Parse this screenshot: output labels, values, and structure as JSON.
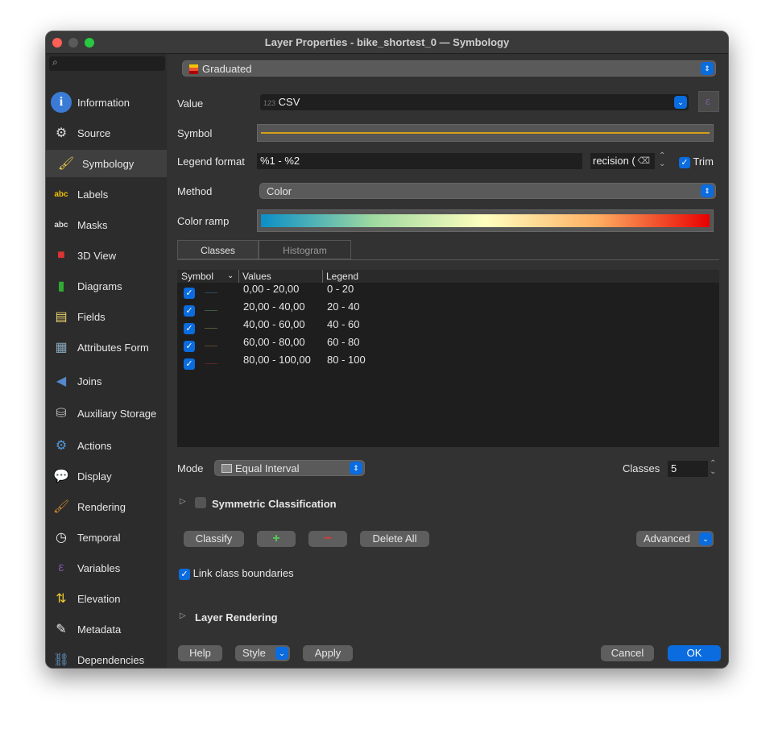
{
  "window": {
    "title": "Layer Properties - bike_shortest_0 — Symbology"
  },
  "sidebar": {
    "items": [
      {
        "label": "Information",
        "icon": "info-icon"
      },
      {
        "label": "Source",
        "icon": "source-icon"
      },
      {
        "label": "Symbology",
        "icon": "symbology-icon",
        "selected": true
      },
      {
        "label": "Labels",
        "icon": "labels-icon"
      },
      {
        "label": "Masks",
        "icon": "masks-icon"
      },
      {
        "label": "3D View",
        "icon": "cube-icon"
      },
      {
        "label": "Diagrams",
        "icon": "diagrams-icon"
      },
      {
        "label": "Fields",
        "icon": "fields-icon"
      },
      {
        "label": "Attributes Form",
        "icon": "form-icon"
      },
      {
        "label": "Joins",
        "icon": "joins-icon"
      },
      {
        "label": "Auxiliary Storage",
        "icon": "storage-icon"
      },
      {
        "label": "Actions",
        "icon": "actions-icon"
      },
      {
        "label": "Display",
        "icon": "display-icon"
      },
      {
        "label": "Rendering",
        "icon": "brush-icon"
      },
      {
        "label": "Temporal",
        "icon": "clock-icon"
      },
      {
        "label": "Variables",
        "icon": "variables-icon"
      },
      {
        "label": "Elevation",
        "icon": "elevation-icon"
      },
      {
        "label": "Metadata",
        "icon": "metadata-icon"
      },
      {
        "label": "Dependencies",
        "icon": "dependencies-icon"
      }
    ]
  },
  "renderer": "Graduated",
  "form": {
    "value_label": "Value",
    "value_type": "123",
    "value": "CSV",
    "symbol_label": "Symbol",
    "symbol_color": "#d4a017",
    "legend_format_label": "Legend format",
    "legend_format": "%1 - %2",
    "precision": "recision (",
    "trim_label": "Trim",
    "trim_checked": true,
    "method_label": "Method",
    "method": "Color",
    "color_ramp_label": "Color ramp"
  },
  "color_ramp": [
    "#0a8fc8",
    "#9fd9a0",
    "#ffffbf",
    "#fdae61",
    "#e80000"
  ],
  "tabs": [
    {
      "label": "Classes",
      "active": true
    },
    {
      "label": "Histogram"
    }
  ],
  "table": {
    "headers": [
      "Symbol",
      "Values",
      "Legend"
    ],
    "rows": [
      {
        "values": "0,00 - 20,00",
        "legend": "0 - 20",
        "color": "#2a4a5c",
        "checked": true
      },
      {
        "values": "20,00 - 40,00",
        "legend": "20 - 40",
        "color": "#3f5a45",
        "checked": true
      },
      {
        "values": "40,00 - 60,00",
        "legend": "40 - 60",
        "color": "#55583d",
        "checked": true
      },
      {
        "values": "60,00 - 80,00",
        "legend": "60 - 80",
        "color": "#5e4a33",
        "checked": true
      },
      {
        "values": "80,00 - 100,00",
        "legend": "80 - 100",
        "color": "#5e2626",
        "checked": true
      }
    ]
  },
  "mode": {
    "label": "Mode",
    "value": "Equal Interval",
    "classes_label": "Classes",
    "classes": "5"
  },
  "symmetric": {
    "label": "Symmetric Classification",
    "checked": false
  },
  "buttons": {
    "classify": "Classify",
    "add": "+",
    "remove": "−",
    "delete_all": "Delete All",
    "advanced": "Advanced"
  },
  "link": {
    "label": "Link class boundaries",
    "checked": true
  },
  "layer_rendering": "Layer Rendering",
  "footer": {
    "help": "Help",
    "style": "Style",
    "apply": "Apply",
    "cancel": "Cancel",
    "ok": "OK"
  }
}
